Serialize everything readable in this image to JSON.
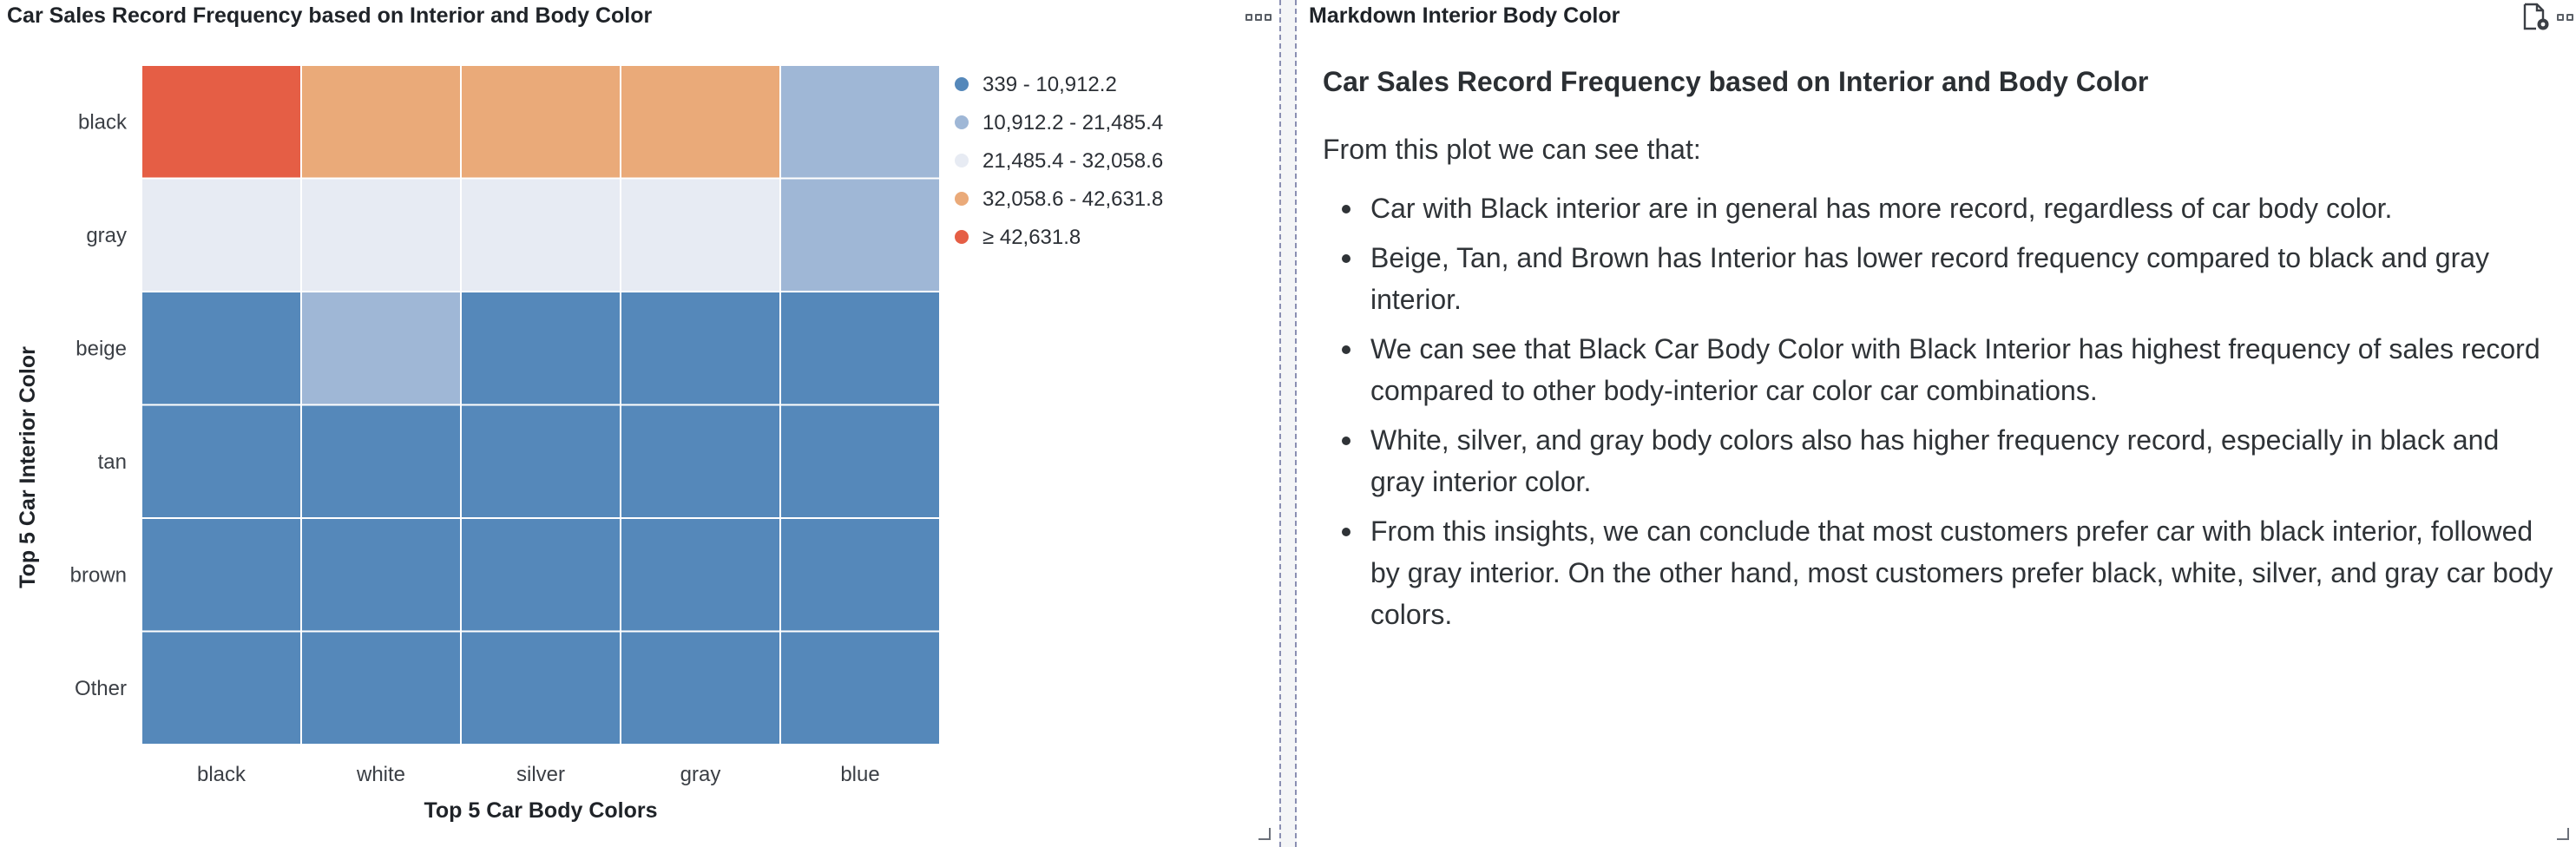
{
  "left_panel": {
    "title": "Car Sales Record Frequency based on Interior and Body Color",
    "menu_icon": "more-options-icon"
  },
  "right_panel": {
    "title": "Markdown Interior Body Color",
    "export_icon": "file-settings-icon",
    "menu_icon": "more-options-icon",
    "markdown": {
      "heading": "Car Sales Record Frequency based on Interior and Body Color",
      "intro": "From this plot we can see that:",
      "bullets": [
        "Car with Black interior are in general has more record, regardless of car body color.",
        "Beige, Tan, and Brown has Interior has lower record frequency compared to black and gray interior.",
        "We can see that Black Car Body Color with Black Interior has highest frequency of sales record compared to other body-interior car color car combinations.",
        "White, silver, and gray body colors also has higher frequency record, especially in black and gray interior color.",
        "From this insights, we can conclude that most customers prefer car with black interior, followed by gray interior. On the other hand, most customers prefer black, white, silver, and gray car body colors."
      ]
    }
  },
  "chart_data": {
    "type": "heatmap",
    "title": "Car Sales Record Frequency based on Interior and Body Color",
    "xlabel": "Top 5 Car Body Colors",
    "ylabel": "Top 5 Car Interior Color",
    "x_categories": [
      "black",
      "white",
      "silver",
      "gray",
      "blue"
    ],
    "y_categories": [
      "black",
      "gray",
      "beige",
      "tan",
      "brown",
      "Other"
    ],
    "cell_bins": [
      [
        4,
        3,
        3,
        3,
        1
      ],
      [
        2,
        2,
        2,
        2,
        1
      ],
      [
        0,
        1,
        0,
        0,
        0
      ],
      [
        0,
        0,
        0,
        0,
        0
      ],
      [
        0,
        0,
        0,
        0,
        0
      ],
      [
        0,
        0,
        0,
        0,
        0
      ]
    ],
    "legend": {
      "position": "top-right",
      "bins": [
        {
          "label": "339 - 10,912.2",
          "color": "#5588ba"
        },
        {
          "label": "10,912.2 - 21,485.4",
          "color": "#9fb7d6"
        },
        {
          "label": "21,485.4 - 32,058.6",
          "color": "#e7ebf3"
        },
        {
          "label": "32,058.6 - 42,631.8",
          "color": "#eaaa79"
        },
        {
          "label": "≥ 42,631.8",
          "color": "#e55e45"
        }
      ]
    }
  }
}
